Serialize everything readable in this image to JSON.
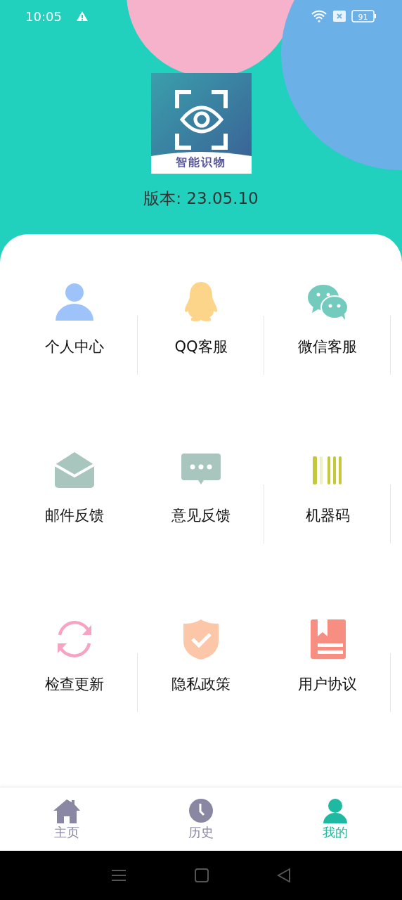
{
  "status_bar": {
    "time": "10:05",
    "battery": "91"
  },
  "app": {
    "logo_text": "智能识物",
    "version": "版本: 23.05.10"
  },
  "menu": [
    {
      "kind": "person",
      "label": "个人中心",
      "color": "#9ec3fb",
      "separator": true
    },
    {
      "kind": "penguin",
      "label": "QQ客服",
      "color": "#fdd58a",
      "separator": true
    },
    {
      "kind": "chat-bubbles",
      "label": "微信客服",
      "color": "#72cbbd",
      "separator": true
    },
    {
      "kind": "envelope",
      "label": "邮件反馈",
      "color": "#a8c6bd",
      "separator": false
    },
    {
      "kind": "message",
      "label": "意见反馈",
      "color": "#a8c6bd",
      "separator": true
    },
    {
      "kind": "barcode",
      "label": "机器码",
      "color": "#c3c93a",
      "separator": true
    },
    {
      "kind": "refresh",
      "label": "检查更新",
      "color": "#f7a3c4",
      "separator": true
    },
    {
      "kind": "shield",
      "label": "隐私政策",
      "color": "#fcc6a8",
      "separator": false
    },
    {
      "kind": "book",
      "label": "用户协议",
      "color": "#f68f82",
      "separator": true
    }
  ],
  "tabs": [
    {
      "kind": "home",
      "label": "主页",
      "selected": false
    },
    {
      "kind": "clock",
      "label": "历史",
      "selected": false
    },
    {
      "kind": "person",
      "label": "我的",
      "selected": true
    }
  ]
}
